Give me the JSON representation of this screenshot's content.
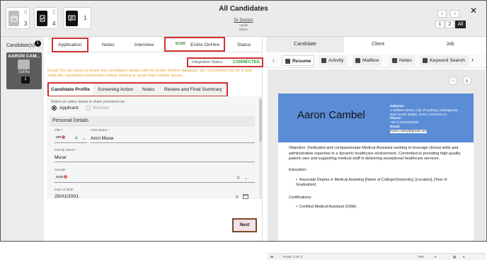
{
  "window": {
    "title": "All Candidates",
    "job_title": "Sr Doctor",
    "client": "Apollo",
    "country": "INDIA",
    "close_icon": "close-icon"
  },
  "top_counters": [
    {
      "icon": "calendar-icon",
      "top": "0",
      "bottom": "3",
      "color": "#9e9e9e"
    },
    {
      "icon": "document-check-icon",
      "top": "2",
      "bottom": "4",
      "color": "#111111"
    },
    {
      "icon": "chat-note-icon",
      "top": "",
      "bottom": "1",
      "color": "#111111"
    }
  ],
  "pager": {
    "prev": "‹",
    "next": "›",
    "pages": [
      "1",
      "2",
      "All"
    ],
    "active_page": "All"
  },
  "rail": {
    "label": "Candidate(s)",
    "count": "1",
    "candidate_name": "AARON CAM...",
    "candidate_percent": "(100%)",
    "candidate_badge": "1"
  },
  "left_tabs": {
    "application": "Application",
    "notes": "Notes",
    "interview": "Interview",
    "entire_onhire": "Entire OnHire",
    "entire_logo": "E⁝OH",
    "status": "Status"
  },
  "integration": {
    "label": "Integration Status :",
    "value": "CONNECTED"
  },
  "notice": "Great! You are about to share this candidate's details with the Entire OnHire database. We recommend you fill in and verify the candidate's information before sharing to avoid data transfer issues.",
  "sub_tabs": {
    "candidate_profile": "Candidate Profile",
    "screening_action": "Screening Action",
    "notes": "Notes",
    "review": "Review and Final Summary"
  },
  "form": {
    "share_prompt": "Select an option below to share personnel as:",
    "applicant": "Applicant",
    "member": "Member",
    "section": "Personal Details",
    "title_label": "Title",
    "title_value": "MR",
    "first_name_label": "First Name",
    "first_name_value": "Arcn Muse",
    "family_name_label": "Family Name",
    "family_name_value": "Muse",
    "gender_label": "Gender",
    "gender_value": "Male",
    "dob_label": "Date of Birth",
    "dob_value": "25/01/2001",
    "required_mark": "*"
  },
  "next_button": "Next",
  "right_tabs": {
    "candidate": "Candidate",
    "client": "Client",
    "job": "Job"
  },
  "right_subtabs": {
    "resume": "Resume",
    "activity": "Activity",
    "mailbox": "Mailbox",
    "notes": "Notes",
    "keyword_search": "Keyword Search"
  },
  "resume": {
    "name": "Aaron Cambel",
    "address_label": "Address:",
    "address_line1": "1 William Street, City of Sydney, Darlinghurst,",
    "address_line2": "New South Wales, 2010, AUSTRALIA",
    "phone_label": "Phone:",
    "phone_value": "+61 0 5342343209",
    "email_label": "Email:",
    "email_value": "Aaron.camy@gmail.com",
    "objective": "Objective: Dedicated and compassionate Medical Assistant seeking to leverage clinical skills and administrative expertise in a dynamic healthcare environment. Committed to providing high-quality patient care and supporting medical staff in delivering exceptional healthcare services.",
    "education_label": "Education:",
    "education_item": "Associate Degree in Medical Assisting [Name of College/University], [Location], [Year of Graduation]",
    "certifications_label": "Certifications:",
    "certification_item": "Certified Medical Assistant (CMA)"
  },
  "doc_footer": {
    "page": "PAGE 1 OF 2",
    "zoom": "75%"
  },
  "colors": {
    "accent_red": "#d32f2f",
    "connected_green": "#2e9d3b",
    "notice_orange": "#e3a43b",
    "resume_blue": "#5b8dd6"
  }
}
